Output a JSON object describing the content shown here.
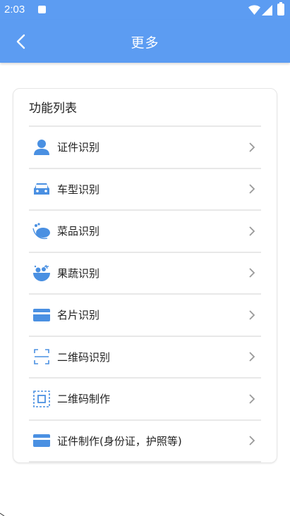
{
  "status_bar": {
    "time": "2:03",
    "icons": [
      "notification-icon",
      "wifi-icon",
      "signal-icon",
      "battery-icon"
    ]
  },
  "app_bar": {
    "title": "更多",
    "back_icon": "back-arrow-icon",
    "color": "#5c9cf2"
  },
  "card": {
    "title": "功能列表",
    "items": [
      {
        "label": "证件识别",
        "icon": "person-icon",
        "icon_color": "#4a90e2"
      },
      {
        "label": "车型识别",
        "icon": "car-icon",
        "icon_color": "#4a90e2"
      },
      {
        "label": "菜品识别",
        "icon": "dish-icon",
        "icon_color": "#4a90e2"
      },
      {
        "label": "果蔬识别",
        "icon": "fruit-bowl-icon",
        "icon_color": "#4a90e2"
      },
      {
        "label": "名片识别",
        "icon": "business-card-icon",
        "icon_color": "#4a90e2"
      },
      {
        "label": "二维码识别",
        "icon": "qr-scan-icon",
        "icon_color": "#4a90e2"
      },
      {
        "label": "二维码制作",
        "icon": "qr-make-icon",
        "icon_color": "#4a90e2"
      },
      {
        "label": "证件制作(身份证，护照等)",
        "icon": "id-card-icon",
        "icon_color": "#4a90e2"
      }
    ],
    "chevron_icon": "chevron-right-icon"
  }
}
